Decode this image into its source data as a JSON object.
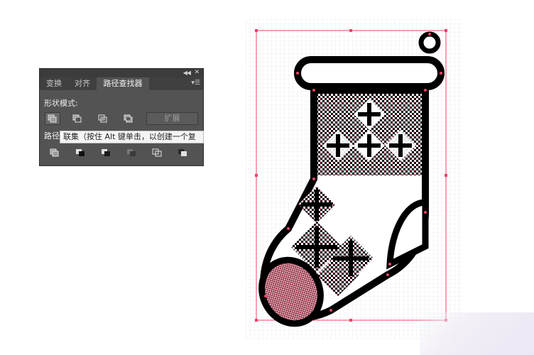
{
  "panel": {
    "tabs": [
      {
        "label": "变换"
      },
      {
        "label": "对齐"
      },
      {
        "label": "路径查找器"
      }
    ],
    "shape_modes_label": "形状模式:",
    "pathfinders_label": "路径",
    "expand_label": "扩展",
    "tooltip": "联集（按住 Alt 键单击，以创建一个复",
    "shape_mode_icons": [
      "unite-icon",
      "minus-front-icon",
      "intersect-icon",
      "exclude-icon"
    ],
    "pathfinder_icons": [
      "divide-icon",
      "trim-icon",
      "merge-icon",
      "crop-icon",
      "outline-icon",
      "minus-back-icon"
    ]
  },
  "artwork": {
    "subject": "christmas-stocking",
    "colors": {
      "outline": "#000000",
      "guide": "#e8446a",
      "grid": "#dcdcdc",
      "pattern": "#9e1d3a"
    }
  }
}
